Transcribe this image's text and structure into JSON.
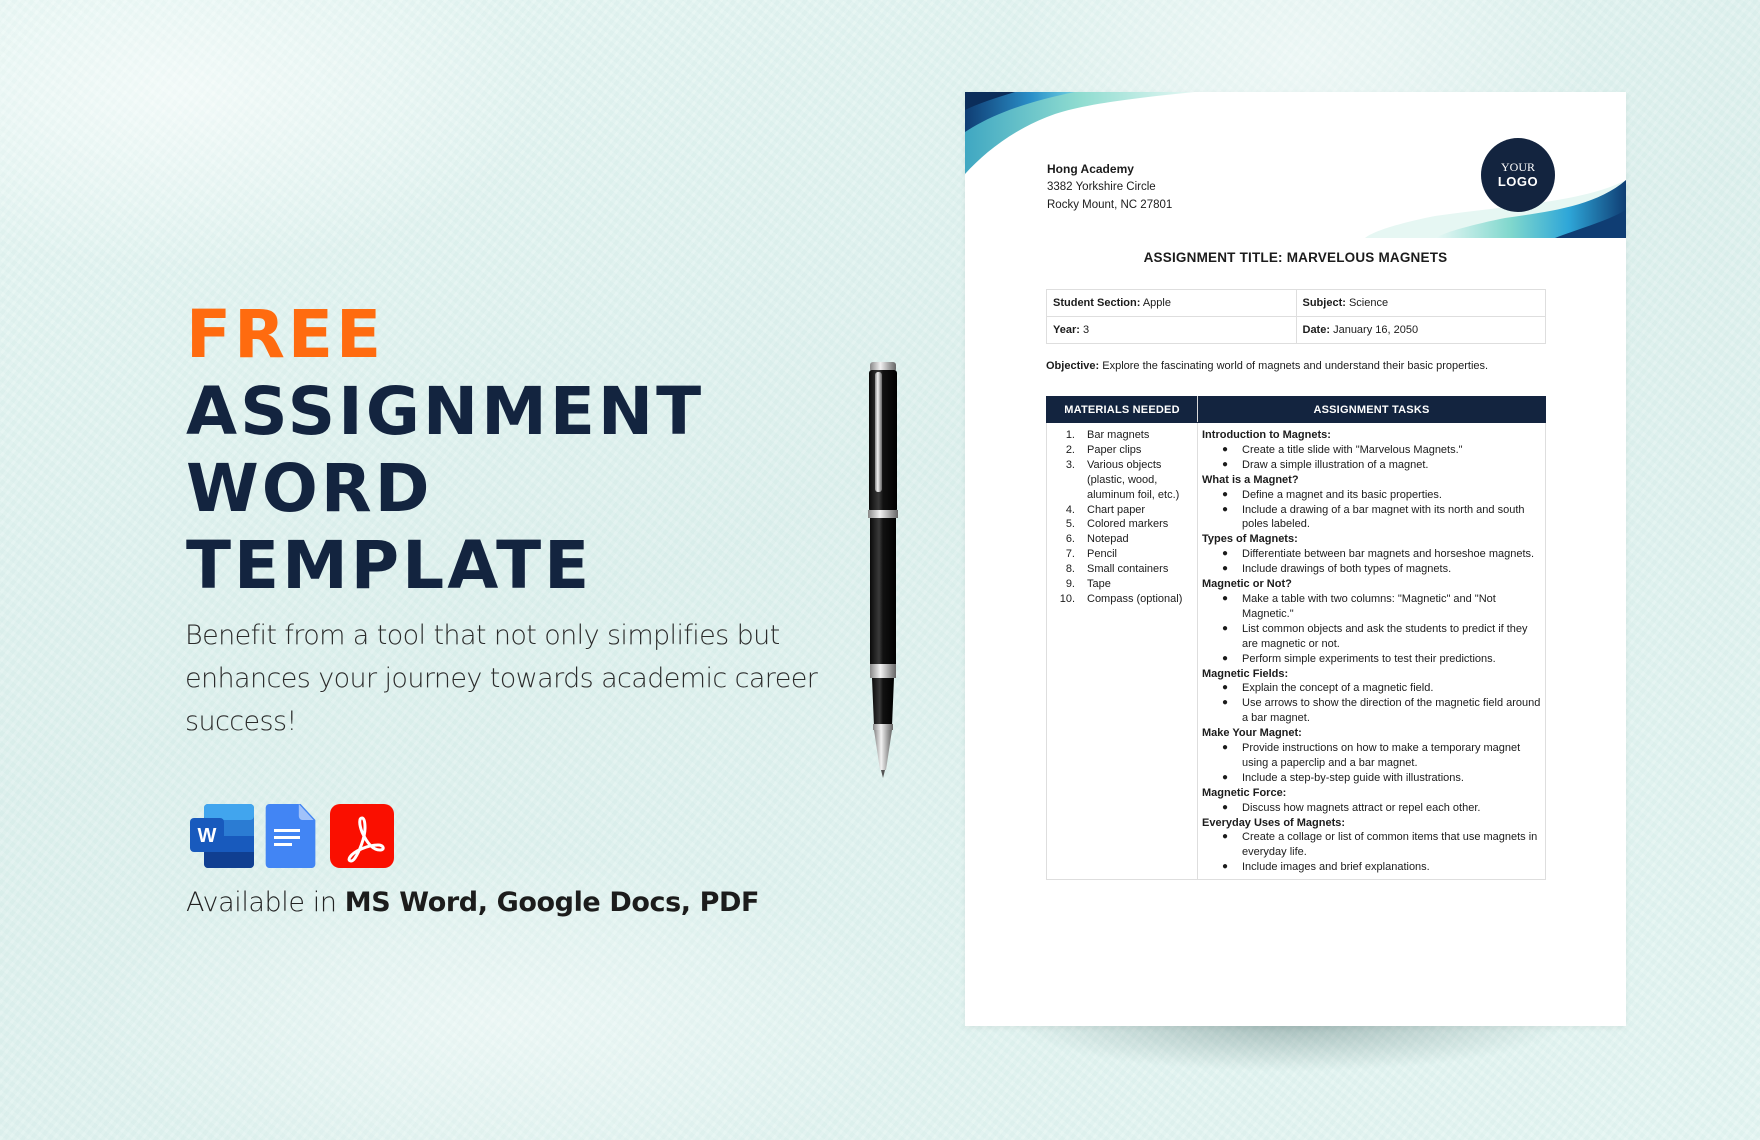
{
  "promo": {
    "free": "FREE",
    "title_lines": [
      "ASSIGNMENT",
      "WORD",
      "TEMPLATE"
    ],
    "tagline": "Benefit from a tool that not only simplifies but enhances your journey towards academic career success!",
    "available_prefix": "Available in",
    "available_formats": "MS Word, Google Docs, PDF",
    "format_icons": [
      "ms-word-icon",
      "google-docs-icon",
      "pdf-icon"
    ],
    "colors": {
      "accent": "#ff6b0f",
      "navy": "#13243f"
    }
  },
  "document": {
    "org": {
      "name": "Hong Academy",
      "address1": "3382 Yorkshire Circle",
      "address2": "Rocky Mount, NC 27801"
    },
    "logo": {
      "line1": "YOUR",
      "line2": "LOGO"
    },
    "title": "ASSIGNMENT TITLE: MARVELOUS MAGNETS",
    "info": {
      "section_label": "Student Section:",
      "section_value": "Apple",
      "subject_label": "Subject:",
      "subject_value": "Science",
      "year_label": "Year:",
      "year_value": "3",
      "date_label": "Date:",
      "date_value": "January 16, 2050"
    },
    "objective_label": "Objective:",
    "objective_text": "Explore the fascinating world of magnets and understand their basic properties.",
    "table": {
      "col1": "MATERIALS NEEDED",
      "col2": "ASSIGNMENT TASKS",
      "materials": [
        {
          "n": "1.",
          "text": "Bar magnets"
        },
        {
          "n": "2.",
          "text": "Paper clips"
        },
        {
          "n": "3.",
          "text": "Various objects (plastic, wood, aluminum foil, etc.)"
        },
        {
          "n": "4.",
          "text": "Chart paper"
        },
        {
          "n": "5.",
          "text": "Colored markers"
        },
        {
          "n": "6.",
          "text": "Notepad"
        },
        {
          "n": "7.",
          "text": "Pencil"
        },
        {
          "n": "8.",
          "text": "Small containers"
        },
        {
          "n": "9.",
          "text": "Tape"
        },
        {
          "n": "10.",
          "text": "Compass (optional)"
        }
      ],
      "tasks": [
        {
          "heading": "Introduction to Magnets:",
          "items": [
            "Create a title slide with \"Marvelous Magnets.\"",
            "Draw a simple illustration of a magnet."
          ]
        },
        {
          "heading": "What is a Magnet?",
          "items": [
            "Define a magnet and its basic properties.",
            "Include a drawing of a bar magnet with its north and south poles labeled."
          ]
        },
        {
          "heading": "Types of Magnets:",
          "items": [
            "Differentiate between bar magnets and horseshoe magnets.",
            "Include drawings of both types of magnets."
          ]
        },
        {
          "heading": "Magnetic or Not?",
          "items": [
            "Make a table with two columns: \"Magnetic\" and \"Not Magnetic.\"",
            "List common objects and ask the students to predict if they are magnetic or not.",
            "Perform simple experiments to test their predictions."
          ]
        },
        {
          "heading": "Magnetic Fields:",
          "items": [
            "Explain the concept of a magnetic field.",
            "Use arrows to show the direction of the magnetic field around a bar magnet."
          ]
        },
        {
          "heading": "Make Your Magnet:",
          "items": [
            "Provide instructions on how to make a temporary magnet using a paperclip and a bar magnet.",
            "Include a step-by-step guide with illustrations."
          ]
        },
        {
          "heading": "Magnetic Force:",
          "items": [
            "Discuss how magnets attract or repel each other."
          ]
        },
        {
          "heading": "Everyday Uses of Magnets:",
          "items": [
            "Create a collage or list of common items that use magnets in everyday life.",
            "Include images and brief explanations."
          ]
        }
      ]
    }
  }
}
